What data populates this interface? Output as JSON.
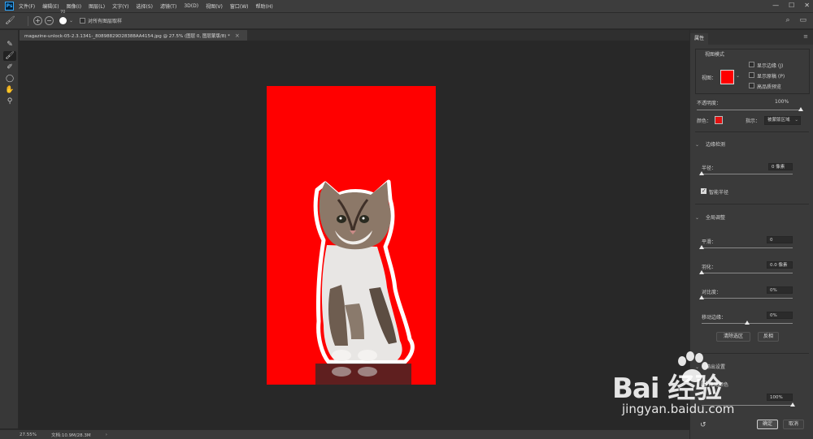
{
  "app": {
    "logo": "Ps",
    "menu": [
      "文件(F)",
      "编辑(E)",
      "图像(I)",
      "图层(L)",
      "文字(Y)",
      "选择(S)",
      "滤镜(T)",
      "3D(D)",
      "视图(V)",
      "窗口(W)",
      "帮助(H)"
    ],
    "window_controls": {
      "minimize": "—",
      "maximize": "☐",
      "close": "✕"
    }
  },
  "options": {
    "brush_size": "70",
    "sample_all_layers": "对所有图层取样"
  },
  "document": {
    "tab_title": "magazine-unlock-05-2.3.1341-_80898829D28388AA4154.jpg @ 27.5% (图层 0, 图层蒙版/8) *",
    "close": "×"
  },
  "status": {
    "zoom": "27.55%",
    "doc_size": "文档:10.9M/28.3M",
    "arrow": "›"
  },
  "panel": {
    "tab": "属性",
    "view_mode_title": "视图模式",
    "view_label": "视图：",
    "show_edge": "显示边缘 (J)",
    "show_original": "显示原稿 (P)",
    "hq_preview": "高品质预览",
    "opacity_label": "不透明度：",
    "opacity_value": "100%",
    "opacity_fraction": 1.0,
    "color_label": "颜色：",
    "indicator_label": "指示：",
    "indicator_value": "被蒙版区域",
    "color_swatch": "#e11111",
    "edge_detection": "边缘检测",
    "radius_label": "半径：",
    "radius_value": "0 像素",
    "radius_fraction": 0.0,
    "smart_radius": "智能半径",
    "global_refine": "全局调整",
    "smooth_label": "平滑：",
    "smooth_value": "0",
    "smooth_fraction": 0.0,
    "feather_label": "羽化：",
    "feather_value": "0.0 像素",
    "feather_fraction": 0.0,
    "contrast_label": "对比度：",
    "contrast_value": "0%",
    "contrast_fraction": 0.0,
    "shift_edge_label": "移动边缘：",
    "shift_edge_value": "0%",
    "shift_edge_fraction": 0.5,
    "clear_selection": "清除选区",
    "invert": "反相",
    "output_settings": "输出设置",
    "output_decontaminate": "净化颜色",
    "amount_value": "100%",
    "amount_fraction": 1.0,
    "ok": "确定",
    "cancel": "取消"
  },
  "watermark": {
    "logo_text": "Bai  经验",
    "url": "jingyan.baidu.com"
  }
}
